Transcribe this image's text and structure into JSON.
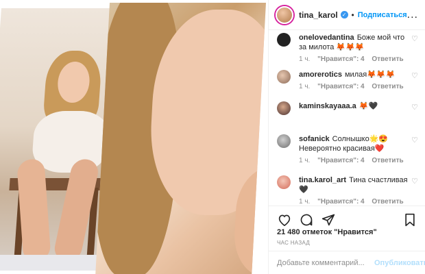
{
  "header": {
    "username": "tina_karol",
    "verified_icon": "verified-badge-icon",
    "separator": "•",
    "follow_label": "Подписаться",
    "more_label": "..."
  },
  "comments": [
    {
      "username": "onelovedantina",
      "text": "Боже мой что за милота 🦊🦊🦊",
      "age": "1 ч.",
      "likes": "\"Нравится\": 4",
      "reply": "Ответить"
    },
    {
      "username": "amorerotics",
      "text": "милая🦊🦊🦊",
      "age": "1 ч.",
      "likes": "\"Нравится\": 4",
      "reply": "Ответить"
    },
    {
      "username": "kaminskayaaa.a",
      "text": "🦊🖤",
      "age": "",
      "likes": "",
      "reply": ""
    },
    {
      "username": "sofanick",
      "text": "Солнышко🌟😍 Невероятно красивая❤️",
      "age": "1 ч.",
      "likes": "\"Нравится\": 4",
      "reply": "Ответить"
    },
    {
      "username": "tina.karol_art",
      "text": "Тина счастливая 🖤",
      "age": "1 ч.",
      "likes": "\"Нравится\": 4",
      "reply": "Ответить"
    }
  ],
  "likes_text": "21 480 отметок \"Нравится\"",
  "time_ago": "ЧАС НАЗАД",
  "add_comment": {
    "placeholder": "Добавьте комментарий...",
    "post_label": "Опубликовать"
  },
  "icons": {
    "like": "heart-icon",
    "comment": "comment-icon",
    "share": "share-icon",
    "save": "bookmark-icon"
  },
  "colors": {
    "accent": "#0095f6",
    "muted": "#8e8e8e",
    "text": "#262626"
  }
}
